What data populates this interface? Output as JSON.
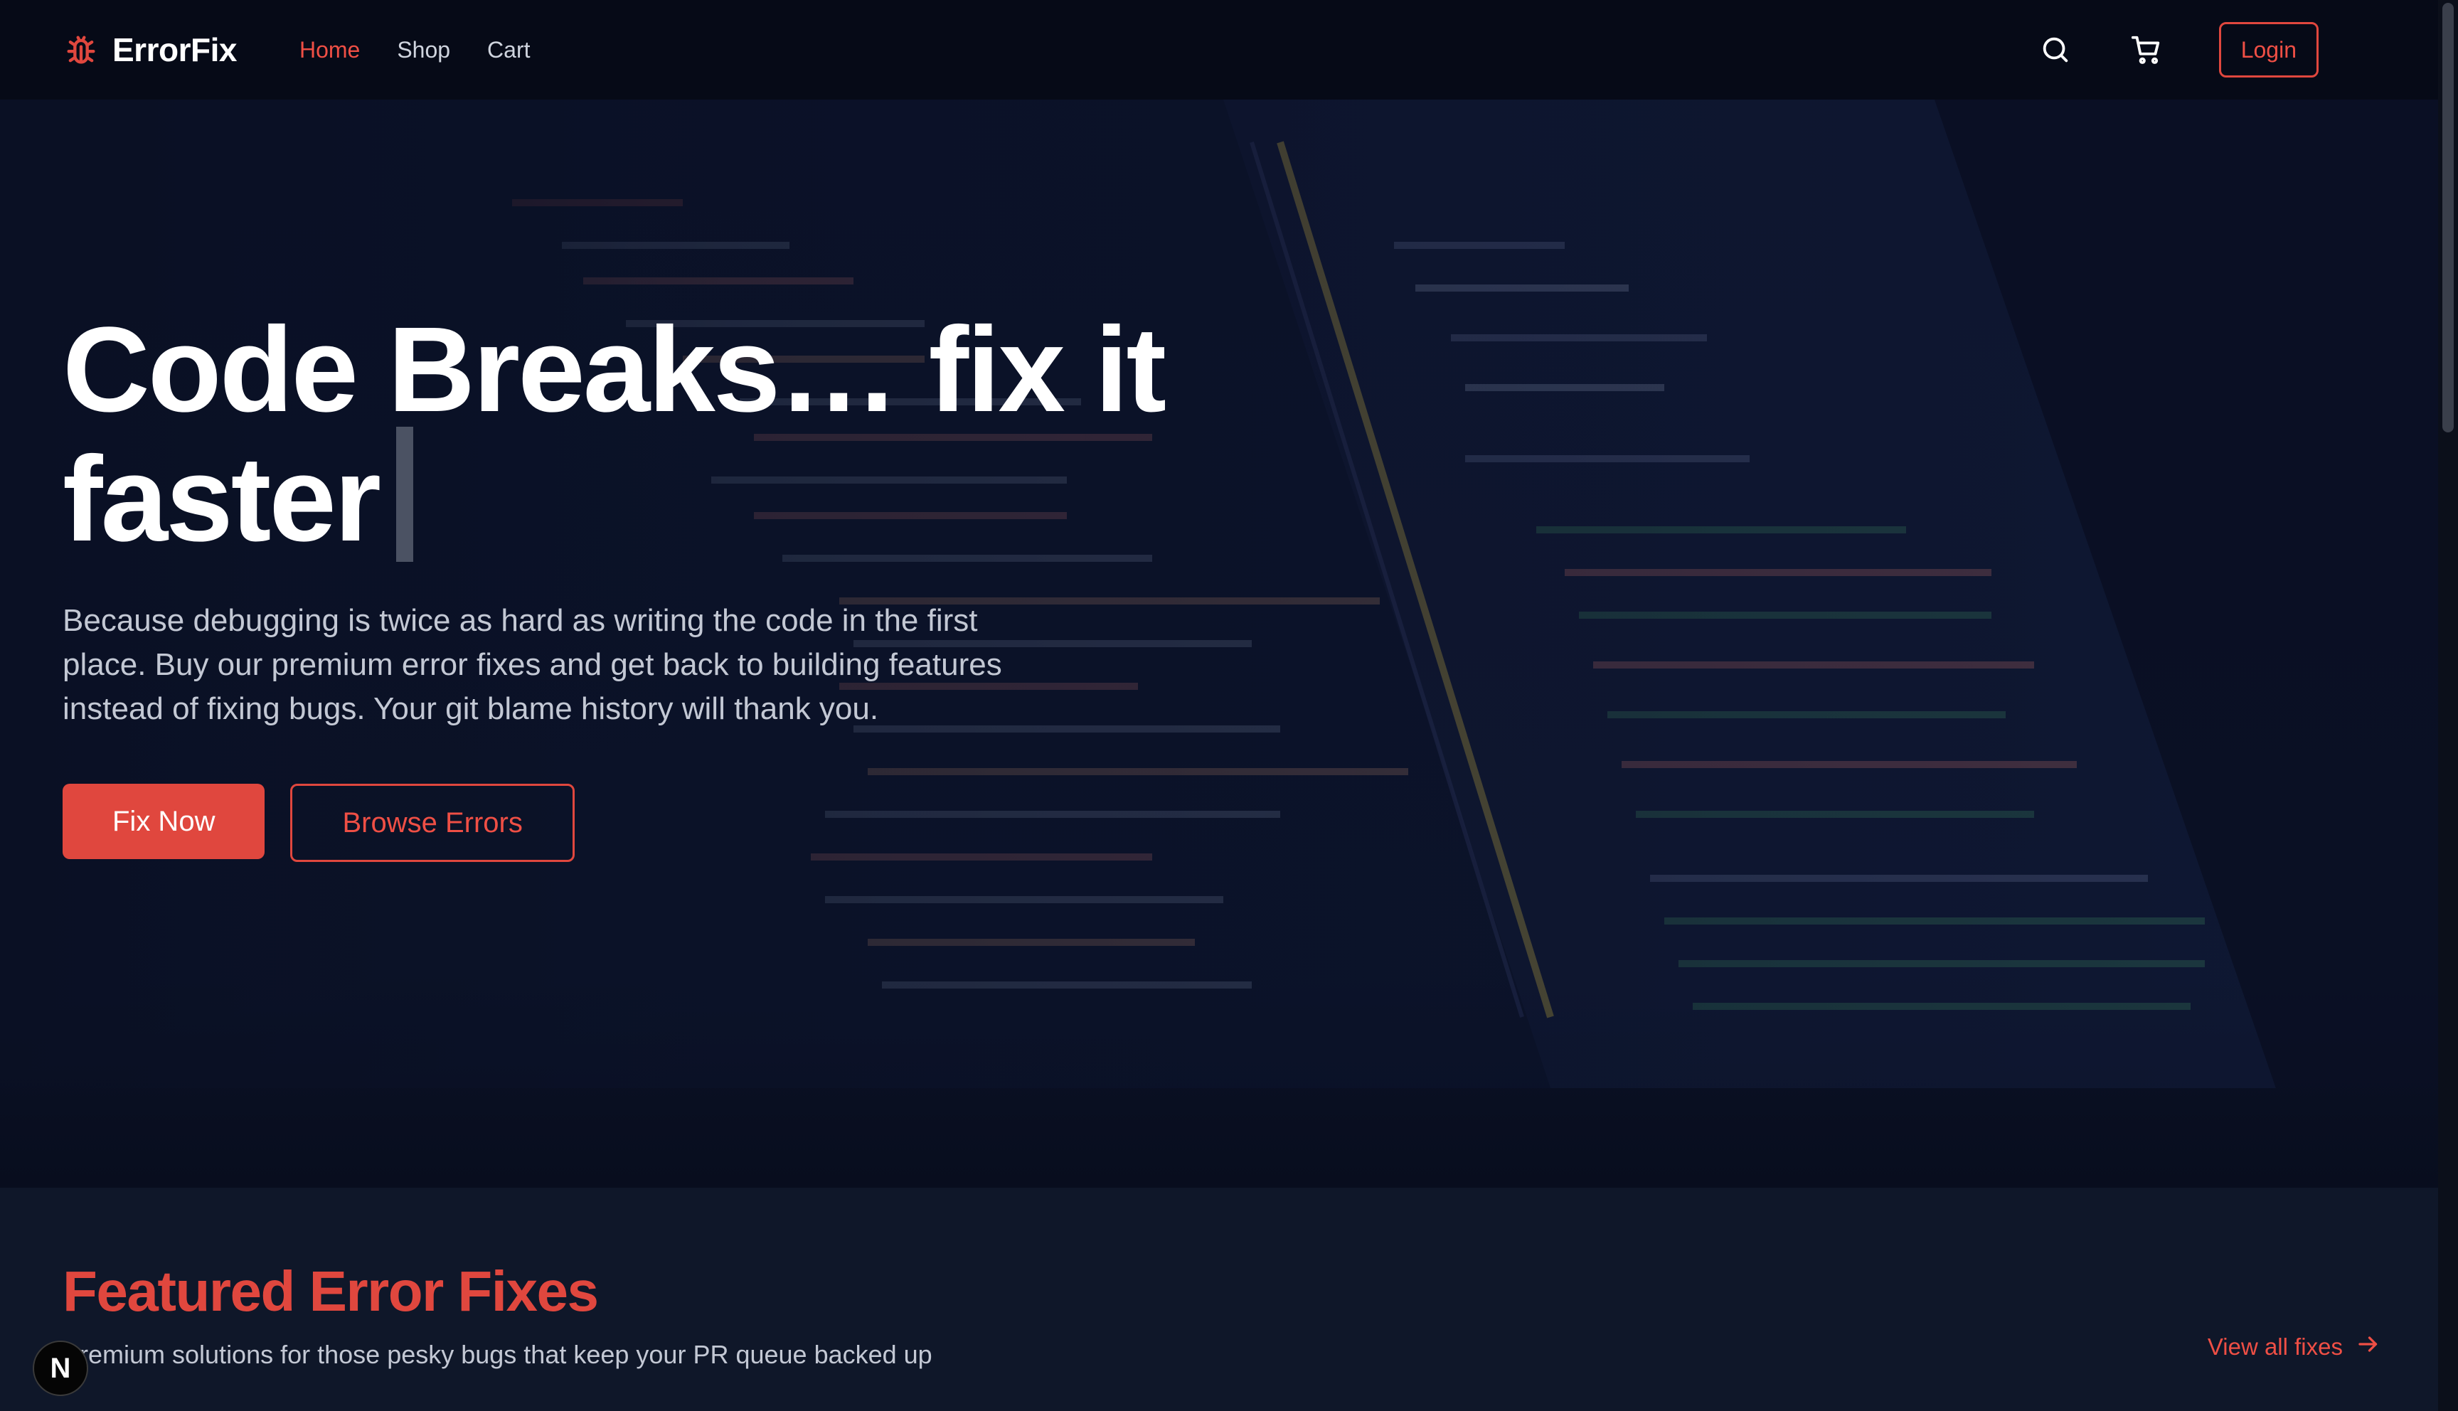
{
  "brand": {
    "name": "ErrorFix",
    "icon": "bug-icon"
  },
  "nav": [
    {
      "label": "Home",
      "active": true
    },
    {
      "label": "Shop",
      "active": false
    },
    {
      "label": "Cart",
      "active": false
    }
  ],
  "header": {
    "search_icon": "search-icon",
    "cart_icon": "cart-icon",
    "login_label": "Login"
  },
  "hero": {
    "title_line1": "Code Breaks… fix it",
    "title_line2": "faster",
    "subtitle": "Because debugging is twice as hard as writing the code in the first place. Buy our premium error fixes and get back to building features instead of fixing bugs. Your git blame history will thank you.",
    "primary_button": "Fix Now",
    "secondary_button": "Browse Errors"
  },
  "featured": {
    "title": "Featured Error Fixes",
    "subtitle": "Premium solutions for those pesky bugs that keep your PR queue backed up",
    "view_all_label": "View all fixes"
  },
  "badge": {
    "label": "N"
  },
  "colors": {
    "accent": "#e0473e",
    "background": "#060a17",
    "section_bg": "#0f1729"
  }
}
